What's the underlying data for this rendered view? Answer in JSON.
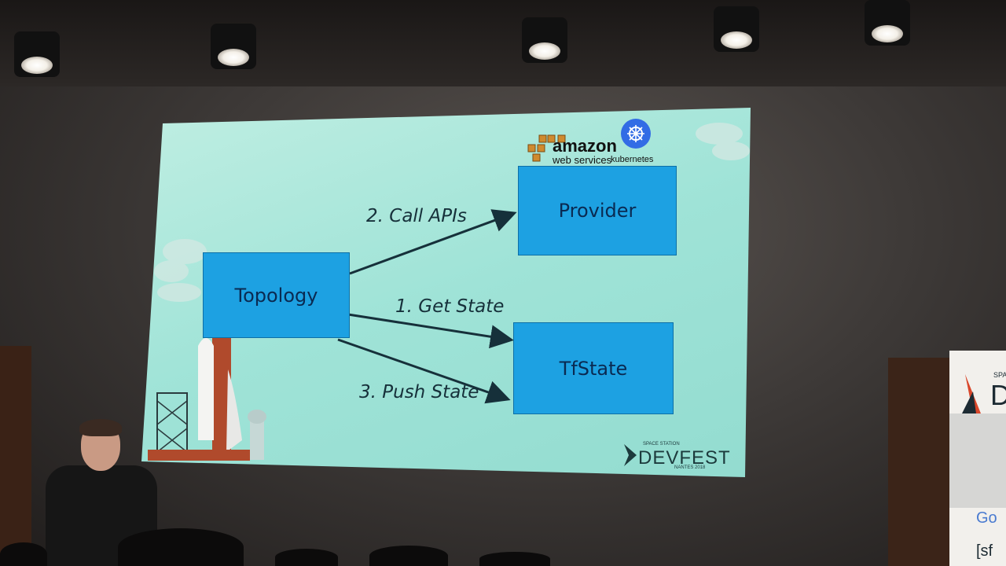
{
  "slide": {
    "boxes": {
      "topology": "Topology",
      "provider": "Provider",
      "tfstate": "TfState"
    },
    "steps": {
      "call_apis": "2.  Call APIs",
      "get_state": "1.  Get State",
      "push_state": "3.  Push State"
    },
    "logos": {
      "amazon": "amazon",
      "webservices": "web services",
      "kubernetes": "kubernetes",
      "event_top": "SPACE STATION",
      "event_name": "DEVFEST",
      "event_bottom": "NANTES 2018"
    },
    "colors": {
      "box_fill": "#1da1e2",
      "slide_background": "#a6e6da",
      "arrow": "#16303a"
    }
  },
  "banner": {
    "top_text": "SPA",
    "letter": "D",
    "line1": "Go",
    "line2": "[sf"
  }
}
